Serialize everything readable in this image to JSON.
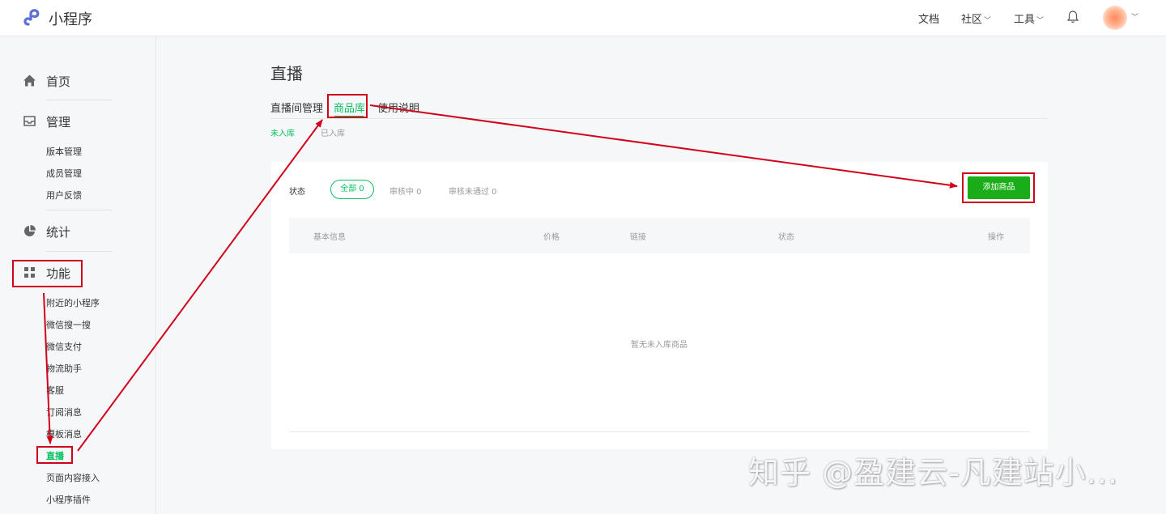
{
  "header": {
    "brand": "小程序",
    "nav": [
      {
        "label": "文档"
      },
      {
        "label": "社区"
      },
      {
        "label": "工具"
      }
    ]
  },
  "sidebar": {
    "home": "首页",
    "manage": {
      "label": "管理",
      "items": [
        "版本管理",
        "成员管理",
        "用户反馈"
      ]
    },
    "stats": "统计",
    "features": {
      "label": "功能",
      "items": [
        "附近的小程序",
        "微信搜一搜",
        "微信支付",
        "物流助手",
        "客服",
        "订阅消息",
        "模板消息",
        "直播",
        "页面内容接入",
        "小程序插件"
      ],
      "active": "直播"
    }
  },
  "main": {
    "title": "直播",
    "tabs": [
      "直播间管理",
      "商品库",
      "使用说明"
    ],
    "active_tab": "商品库",
    "subtabs": [
      "未入库",
      "已入库"
    ],
    "active_subtab": "未入库",
    "status_label": "状态",
    "filters": [
      "全部 0",
      "审核中 0",
      "审核未通过 0"
    ],
    "add_button": "添加商品",
    "columns": [
      "基本信息",
      "价格",
      "链接",
      "状态",
      "操作"
    ],
    "empty_text": "暂无未入库商品"
  },
  "watermark": "知乎 @盈建云-凡建站小...",
  "colors": {
    "accent": "#07c160",
    "button": "#1aad19",
    "annotation": "#d0021b"
  }
}
